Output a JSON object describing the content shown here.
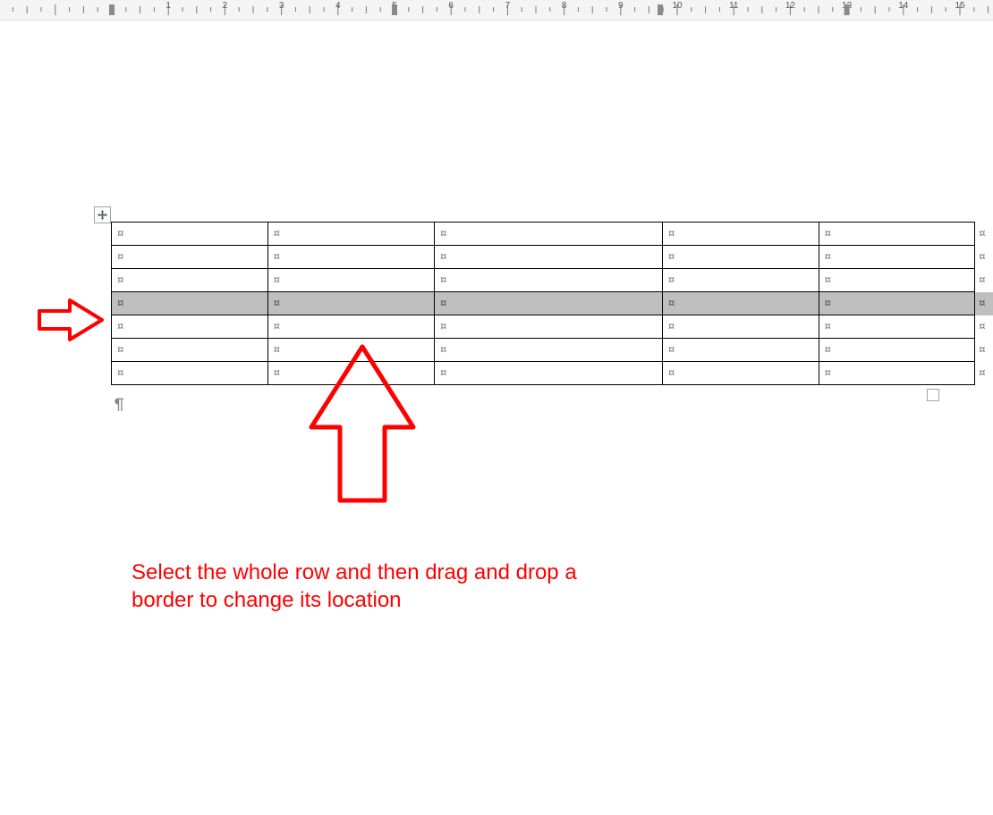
{
  "ruler": {
    "numbers": [
      "1",
      "2",
      "3",
      "4",
      "5",
      "6",
      "7",
      "8",
      "9",
      "10",
      "11",
      "12",
      "13",
      "14",
      "15"
    ]
  },
  "table": {
    "cols_normal": 5,
    "rows": 7,
    "selected_row_index": 3,
    "cell_marker": "¤",
    "end_marker": "¤"
  },
  "paragraph_mark": "¶",
  "annotation": {
    "line1": "Select the whole row and then drag and drop a",
    "line2": "border to change its location"
  }
}
